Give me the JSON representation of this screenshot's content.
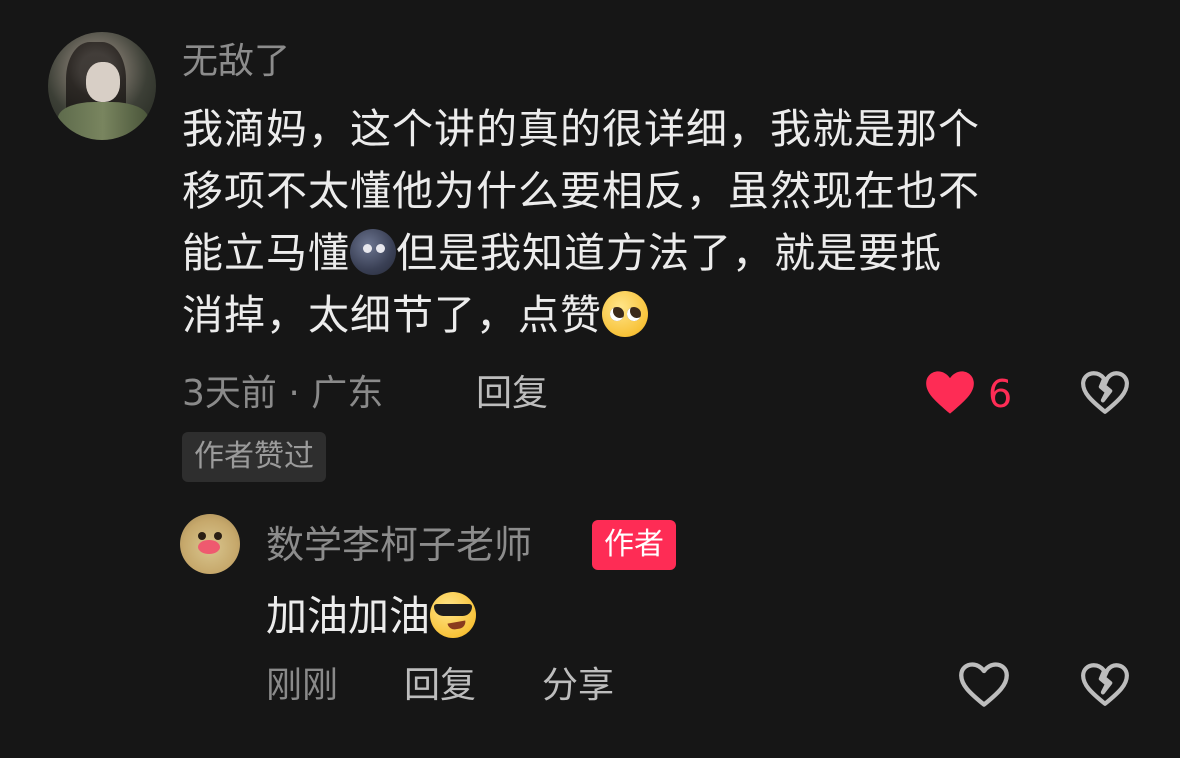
{
  "comment": {
    "username": "无敌了",
    "lines": [
      "我滴妈，这个讲的真的很详细，我就是那个",
      "移项不太懂他为什么要相反，虽然现在也不",
      "能立马懂",
      "但是我知道方法了，就是要抵",
      "消掉，太细节了，点赞"
    ],
    "time_location": "3天前 · 广东",
    "reply_label": "回复",
    "like_count": "6",
    "liked": true,
    "author_liked_tag": "作者赞过",
    "accent_color": "#fe2c55"
  },
  "reply": {
    "username": "数学李柯子老师",
    "author_badge": "作者",
    "text": "加油加油",
    "time": "刚刚",
    "reply_label": "回复",
    "share_label": "分享"
  }
}
